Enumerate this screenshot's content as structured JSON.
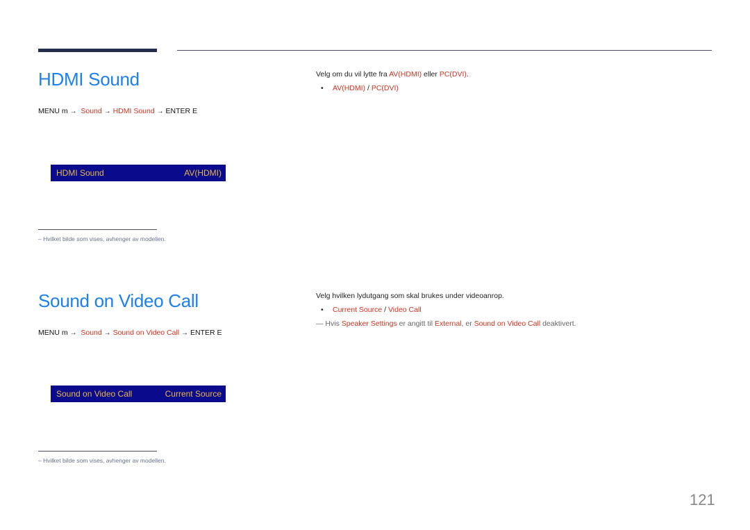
{
  "colors": {
    "heading": "#1c7ff2",
    "highlight": "#d2321f",
    "osd_background": "#0a0a8c",
    "osd_text": "#e8b84a",
    "rule": "#252d4c"
  },
  "sections": [
    {
      "title": "HDMI Sound",
      "menu_path": {
        "prefix": "MENU m",
        "arrow": "→",
        "steps": [
          "Sound",
          "HDMI Sound"
        ],
        "suffix": "ENTER E"
      },
      "osd": {
        "label": "HDMI Sound",
        "value": "AV(HDMI)"
      },
      "footnote": "–  Hvilket bilde som vises, avhenger av modellen.",
      "description": {
        "text_before": "Velg om du vil lytte fra ",
        "opt1": "AV(HDMI)",
        "text_mid": " eller ",
        "opt2": "PC(DVI)",
        "text_after": "."
      },
      "bullet": {
        "dot": "•",
        "opt1": "AV(HDMI)",
        "sep": " / ",
        "opt2": "PC(DVI)"
      }
    },
    {
      "title": "Sound on Video Call",
      "menu_path": {
        "prefix": "MENU m",
        "arrow": "→",
        "steps": [
          "Sound",
          "Sound on Video Call"
        ],
        "suffix": "ENTER E"
      },
      "osd": {
        "label": "Sound on Video Call",
        "value": "Current Source"
      },
      "footnote": "–  Hvilket bilde som vises, avhenger av modellen.",
      "description": {
        "text": "Velg hvilken lydutgang som skal brukes under videoanrop."
      },
      "bullet": {
        "dot": "•",
        "opt1": "Current Source",
        "sep": " / ",
        "opt2": "Video Call"
      },
      "note": {
        "mark": "―",
        "t1": " Hvis ",
        "h1": "Speaker Settings",
        "t2": " er angitt til ",
        "h2": "External",
        "t3": ", er ",
        "h3": "Sound on Video Call",
        "t4": " deaktivert."
      }
    }
  ],
  "page_number": "121"
}
